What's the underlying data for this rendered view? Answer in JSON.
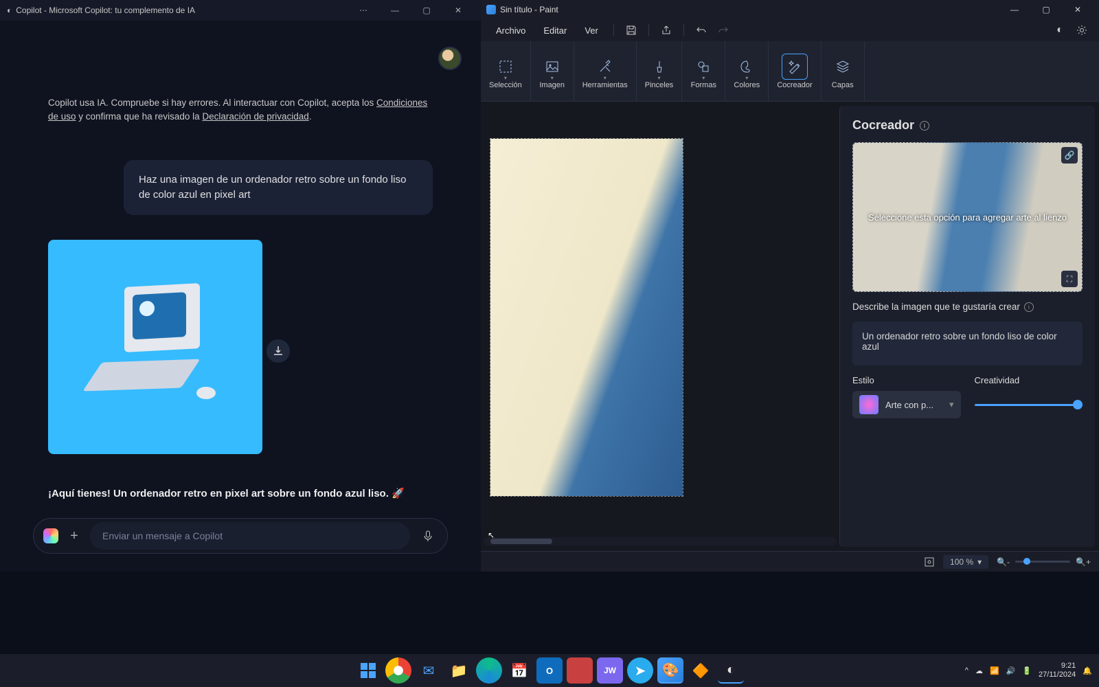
{
  "copilot": {
    "title": "Copilot - Microsoft Copilot: tu complemento de IA",
    "disclaimer_pre": "Copilot usa IA. Compruebe si hay errores. Al interactuar con Copilot, acepta los ",
    "terms_link": "Condiciones de uso",
    "disclaimer_mid": " y confirma que ha revisado la ",
    "privacy_link": "Declaración de privacidad",
    "disclaimer_end": ".",
    "user_prompt": "Haz una imagen de un ordenador retro sobre un fondo liso de color azul en pixel art",
    "caption": "¡Aquí tienes! Un ordenador retro en pixel art sobre un fondo azul liso. 🚀",
    "input_placeholder": "Enviar un mensaje a Copilot"
  },
  "paint": {
    "title": "Sin título - Paint",
    "menus": {
      "file": "Archivo",
      "edit": "Editar",
      "view": "Ver"
    },
    "ribbon": {
      "seleccion": "Selección",
      "imagen": "Imagen",
      "herramientas": "Herramientas",
      "pinceles": "Pinceles",
      "formas": "Formas",
      "colores": "Colores",
      "cocreador": "Cocreador",
      "capas": "Capas"
    },
    "panel": {
      "title": "Cocreador",
      "preview_hint": "Seleccione esta opción para agregar arte al lienzo",
      "describe_label": "Describe la imagen que te gustaría crear",
      "prompt_value": "Un ordenador retro sobre un fondo liso de color azul",
      "style_label": "Estilo",
      "style_value": "Arte con p...",
      "creativity_label": "Creatividad"
    },
    "zoom_pct": "100 %"
  },
  "taskbar": {
    "time": "9:21",
    "date": "27/11/2024"
  }
}
